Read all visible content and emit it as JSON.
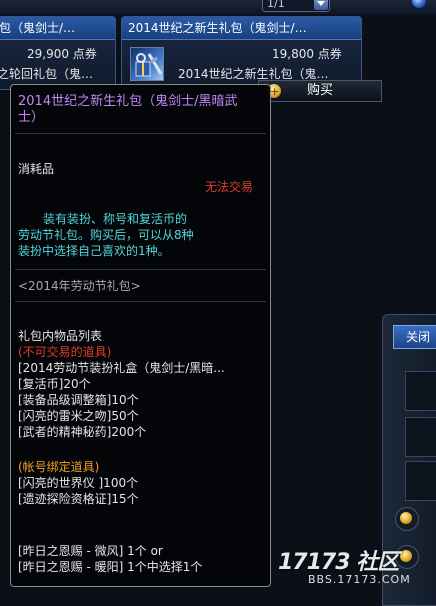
{
  "shop": {
    "pager": "1/1",
    "cards": [
      {
        "title": "包（鬼剑士/…",
        "price": "29,900 点券",
        "subtitle": "之轮回礼包（鬼…"
      },
      {
        "title": "2014世纪之新生礼包（鬼剑士/…",
        "price": "19,800 点券",
        "subtitle": "2014世纪之新生礼包（鬼…",
        "icon": "gift-box-sword-icon"
      }
    ],
    "buy_label": "购买",
    "right_panel": {
      "button_label": "关闭"
    }
  },
  "tooltip": {
    "title": "2014世纪之新生礼包（鬼剑士/黑暗武士）",
    "type": "消耗品",
    "trade_status": "无法交易",
    "description": [
      "装有装扮、称号和复活币的",
      "劳动节礼包。购买后，可以从8种",
      "装扮中选择自己喜欢的1种。"
    ],
    "series": "<2014年劳动节礼包>",
    "contents_header": "礼包内物品列表",
    "untradable_header": "(不可交易的道具)",
    "untradable_items": [
      "[2014劳动节装扮礼盒（鬼剑士/黑暗...",
      "[复活币]20个",
      "[装备品级调整箱]10个",
      "[闪亮的雷米之吻]50个",
      "[武者的精神秘药]200个"
    ],
    "account_bound_header": "(帐号绑定道具)",
    "account_bound_items": [
      "[闪亮的世界仪 ]100个",
      "[遗迹探险资格证]15个"
    ],
    "choice_items": [
      "[昨日之恩赐 - 微风] 1个 or",
      "[昨日之恩赐 - 暖阳] 1个中选择1个"
    ]
  },
  "watermark": {
    "logo": "17173 社区",
    "url": "BBS.17173.COM"
  },
  "colors": {
    "title_purple": "#c488f5",
    "description_cyan": "#52d6d8",
    "untradable_red": "#e03c2c",
    "bound_orange": "#f0a020"
  }
}
